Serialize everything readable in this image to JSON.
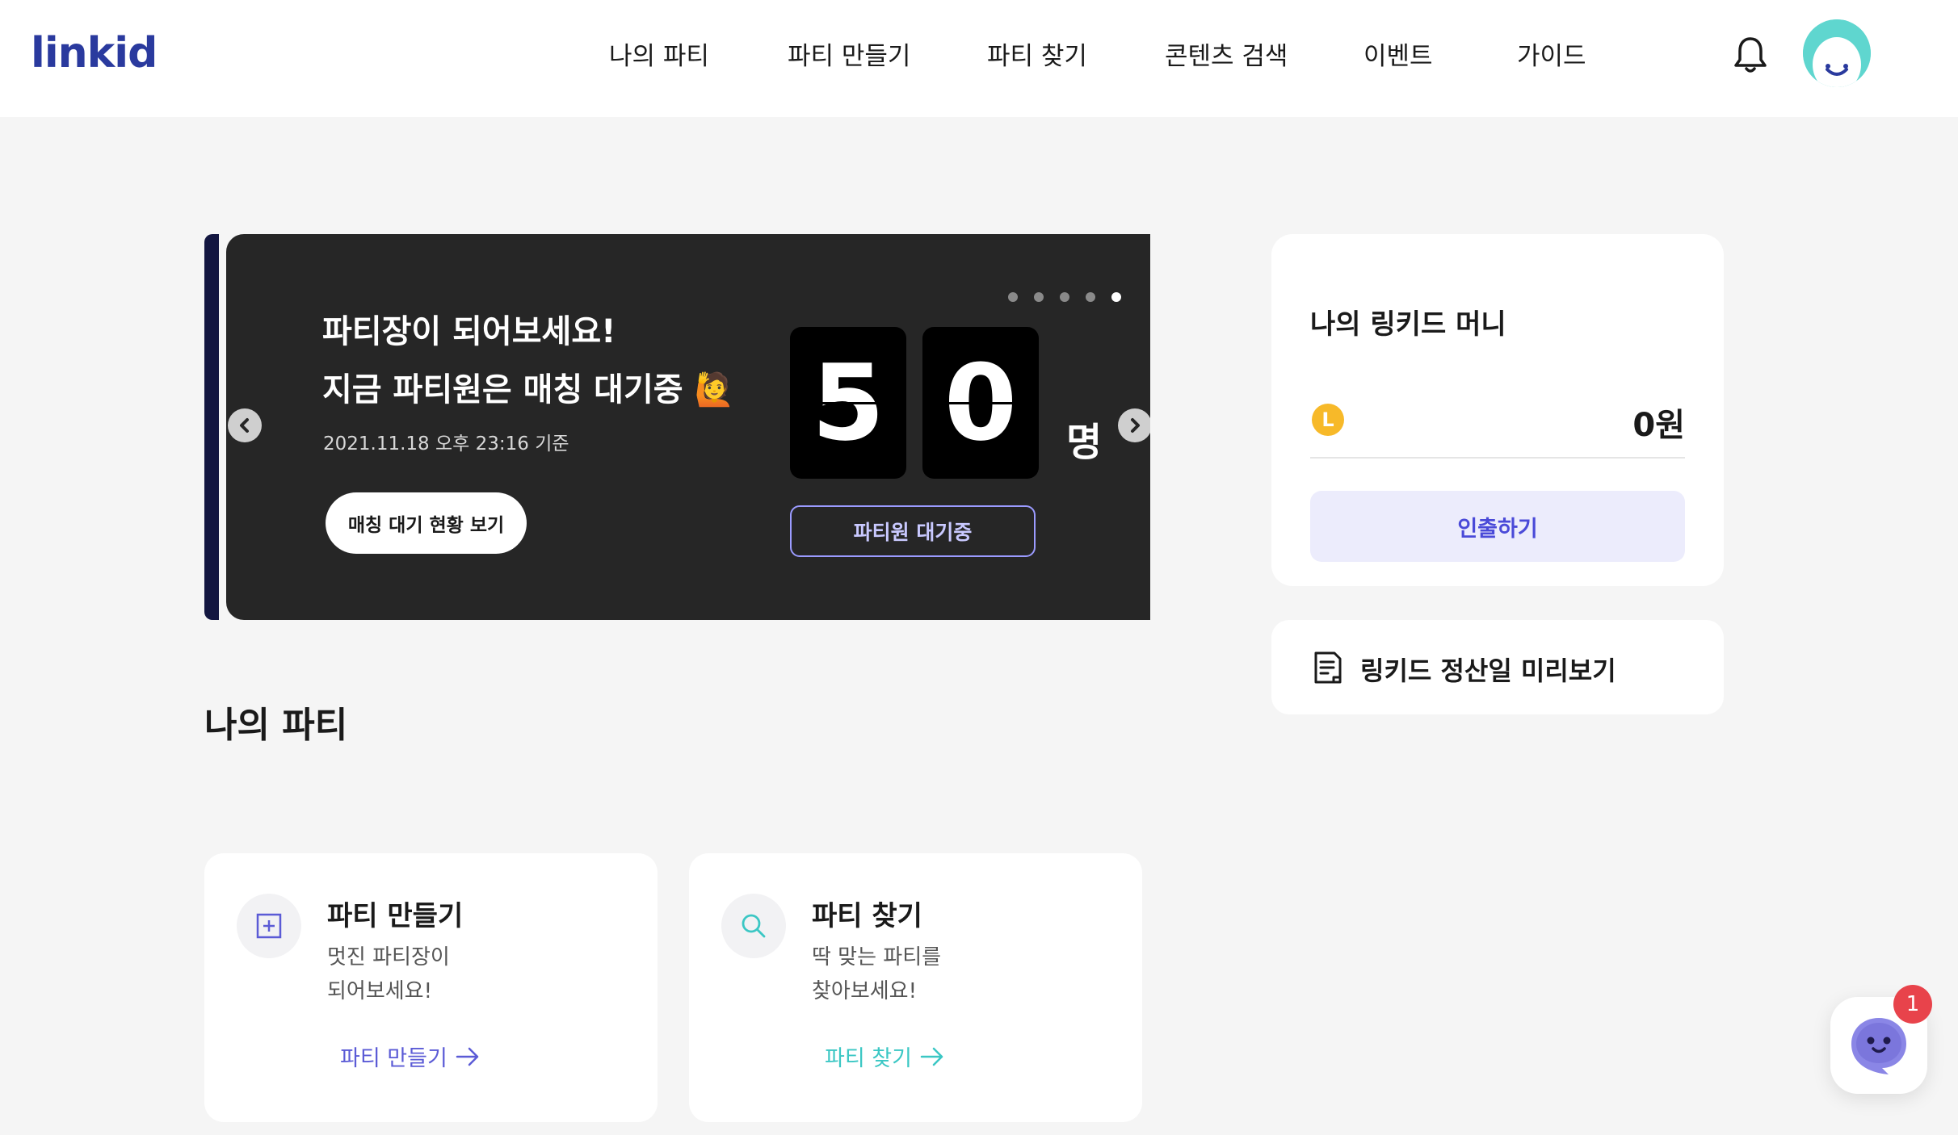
{
  "header": {
    "logo": "linkid",
    "nav": [
      "나의 파티",
      "파티 만들기",
      "파티 찾기",
      "콘텐츠 검색",
      "이벤트",
      "가이드"
    ],
    "icons": {
      "notifications": "bell-icon",
      "profile": "avatar"
    }
  },
  "hero": {
    "title_line1": "파티장이 되어보세요!",
    "title_line2": "지금 파티원은 매칭 대기중 🙋",
    "timestamp": "2021.11.18 오후 23:16 기준",
    "button_label": "매칭 대기 현황 보기",
    "count_digits": [
      "5",
      "0"
    ],
    "count_unit": "명",
    "status_label": "파티원 대기중",
    "slide_count": 5,
    "active_slide": 5
  },
  "my_party": {
    "title": "나의 파티",
    "cards": [
      {
        "title": "파티 만들기",
        "desc_line1": "멋진 파티장이",
        "desc_line2": "되어보세요!",
        "link_label": "파티 만들기",
        "icon": "plus-square-icon",
        "accent": "#5b5bd6"
      },
      {
        "title": "파티 찾기",
        "desc_line1": "딱 맞는 파티를",
        "desc_line2": "찾아보세요!",
        "link_label": "파티 찾기",
        "icon": "search-icon",
        "accent": "#3bc7c4"
      }
    ]
  },
  "money": {
    "title": "나의 링키드 머니",
    "coin_label": "L",
    "amount": "0원",
    "withdraw_label": "인출하기"
  },
  "settlement": {
    "label": "링키드 정산일 미리보기",
    "icon": "document-icon"
  },
  "chat": {
    "badge_count": "1",
    "icon": "chat-bot-icon"
  }
}
